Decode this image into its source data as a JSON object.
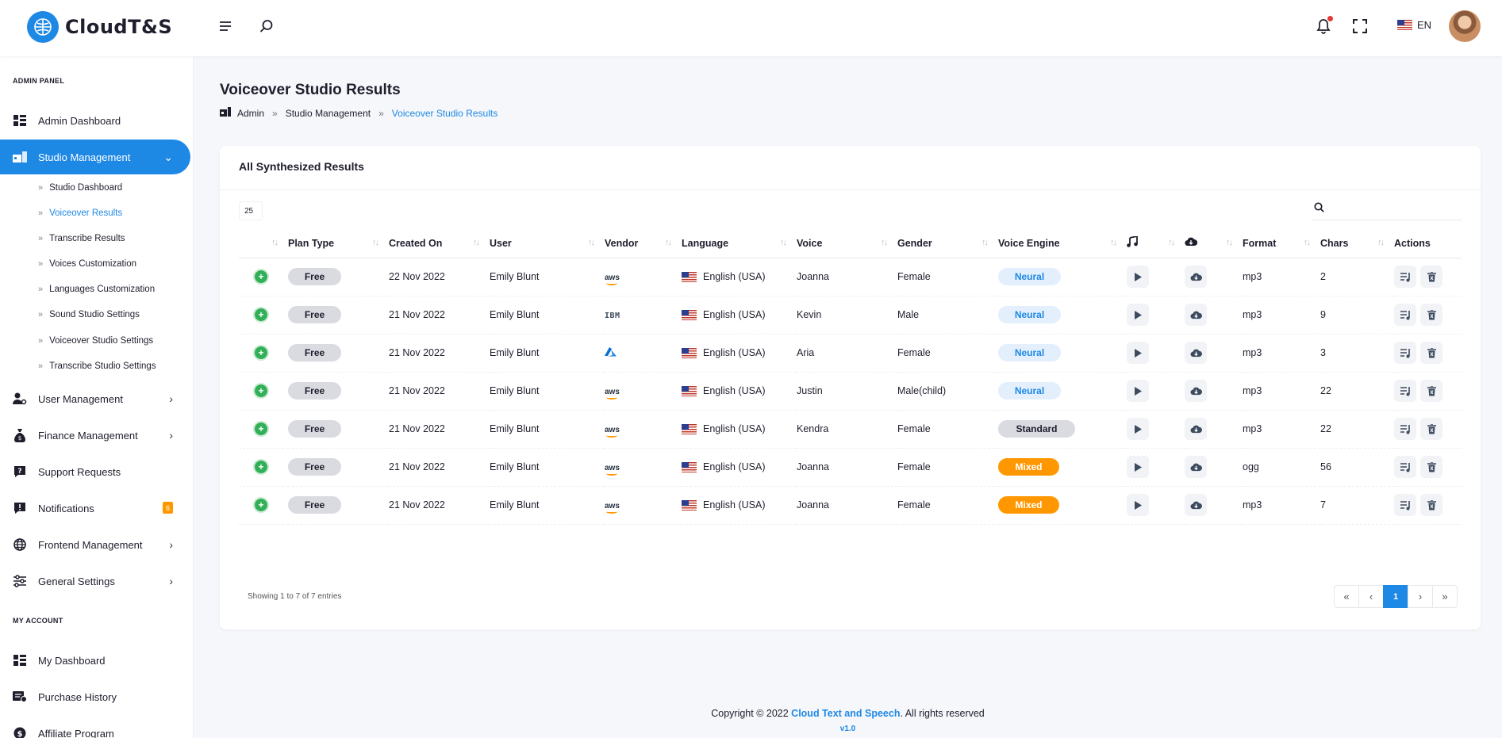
{
  "app": {
    "logo_text": "CloudT&S"
  },
  "header": {
    "language": "EN"
  },
  "sidebar": {
    "admin_section": "ADMIN PANEL",
    "items": [
      {
        "label": "Admin Dashboard"
      },
      {
        "label": "Studio Management"
      },
      {
        "label": "User Management"
      },
      {
        "label": "Finance Management"
      },
      {
        "label": "Support Requests"
      },
      {
        "label": "Notifications",
        "badge": "6"
      },
      {
        "label": "Frontend Management"
      },
      {
        "label": "General Settings"
      }
    ],
    "studio_sub": [
      "Studio Dashboard",
      "Voiceover Results",
      "Transcribe Results",
      "Voices Customization",
      "Languages Customization",
      "Sound Studio Settings",
      "Voiceover Studio Settings",
      "Transcribe Studio Settings"
    ],
    "account_section": "MY ACCOUNT",
    "account_items": [
      {
        "label": "My Dashboard"
      },
      {
        "label": "Purchase History"
      },
      {
        "label": "Affiliate Program"
      }
    ]
  },
  "page": {
    "title": "Voiceover Studio Results",
    "breadcrumb": [
      "Admin",
      "Studio Management",
      "Voiceover Studio Results"
    ]
  },
  "card": {
    "title": "All Synthesized Results",
    "page_size": "25",
    "search_placeholder": "",
    "columns": [
      "Plan Type",
      "Created On",
      "User",
      "Vendor",
      "Language",
      "Voice",
      "Gender",
      "Voice Engine",
      "",
      "",
      "Format",
      "Chars",
      "Actions"
    ],
    "rows": [
      {
        "plan": "Free",
        "created": "22 Nov 2022",
        "user": "Emily Blunt",
        "vendor": "aws",
        "language": "English (USA)",
        "voice": "Joanna",
        "gender": "Female",
        "engine": "Neural",
        "format": "mp3",
        "chars": "2"
      },
      {
        "plan": "Free",
        "created": "21 Nov 2022",
        "user": "Emily Blunt",
        "vendor": "IBM",
        "language": "English (USA)",
        "voice": "Kevin",
        "gender": "Male",
        "engine": "Neural",
        "format": "mp3",
        "chars": "9"
      },
      {
        "plan": "Free",
        "created": "21 Nov 2022",
        "user": "Emily Blunt",
        "vendor": "azure",
        "language": "English (USA)",
        "voice": "Aria",
        "gender": "Female",
        "engine": "Neural",
        "format": "mp3",
        "chars": "3"
      },
      {
        "plan": "Free",
        "created": "21 Nov 2022",
        "user": "Emily Blunt",
        "vendor": "aws",
        "language": "English (USA)",
        "voice": "Justin",
        "gender": "Male(child)",
        "engine": "Neural",
        "format": "mp3",
        "chars": "22"
      },
      {
        "plan": "Free",
        "created": "21 Nov 2022",
        "user": "Emily Blunt",
        "vendor": "aws",
        "language": "English (USA)",
        "voice": "Kendra",
        "gender": "Female",
        "engine": "Standard",
        "format": "mp3",
        "chars": "22"
      },
      {
        "plan": "Free",
        "created": "21 Nov 2022",
        "user": "Emily Blunt",
        "vendor": "aws",
        "language": "English (USA)",
        "voice": "Joanna",
        "gender": "Female",
        "engine": "Mixed",
        "format": "ogg",
        "chars": "56"
      },
      {
        "plan": "Free",
        "created": "21 Nov 2022",
        "user": "Emily Blunt",
        "vendor": "aws",
        "language": "English (USA)",
        "voice": "Joanna",
        "gender": "Female",
        "engine": "Mixed",
        "format": "mp3",
        "chars": "7"
      }
    ],
    "showing": "Showing 1 to 7 of 7 entries",
    "pager": {
      "first": "«",
      "prev": "‹",
      "current": "1",
      "next": "›",
      "last": "»"
    }
  },
  "footer": {
    "prefix": "Copyright © 2022 ",
    "brand": "Cloud Text and Speech",
    "suffix": ". All rights reserved",
    "version": "v1.0"
  },
  "colors": {
    "accent": "#1e88e5",
    "mixed": "#ff9800",
    "plus": "#31b057"
  }
}
